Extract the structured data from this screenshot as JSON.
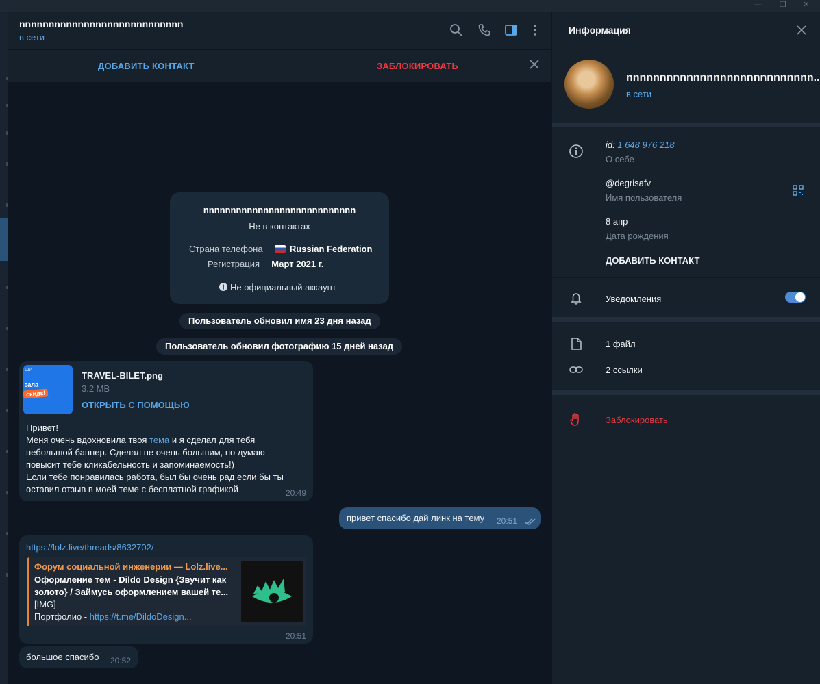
{
  "chat": {
    "header": {
      "name": "nnnnnnnnnnnnnnnnnnnnnnnnnnnn",
      "status": "в сети"
    },
    "actions": {
      "add_contact": "ДОБАВИТЬ КОНТАКТ",
      "block": "ЗАБЛОКИРОВАТЬ"
    },
    "info_card": {
      "name": "nnnnnnnnnnnnnnnnnnnnnnnnnnnn",
      "subtitle": "Не в контактах",
      "phone_country_label": "Страна телефона",
      "phone_country_value": "Russian Federation",
      "registration_label": "Регистрация",
      "registration_value": "Март 2021 г.",
      "warning": "Не официальный аккаунт"
    },
    "service_messages": [
      "Пользователь обновил имя 23 дня назад",
      "Пользователь обновил фотографию 15 дней назад"
    ],
    "messages": [
      {
        "file_name": "TRAVEL-BILET.png",
        "file_size": "3.2 MB",
        "open_with": "ОТКРЫТЬ С ПОМОЩЬЮ",
        "thumb_top": "ШИ",
        "thumb_line1": "зала —",
        "thumb_line2": "скидк!",
        "text_before_link": "Привет!\nМеня очень вдохновила твоя ",
        "link_text": "тема",
        "text_after_link": " и я сделал для тебя\nнебольшой баннер. Сделал не очень большим, но думаю\nповысит тебе кликабельность и запоминаемость!)\nЕсли тебе понравилась работа, был бы очень рад если бы ты\nоставил отзыв в моей теме с бесплатной графикой",
        "time": "20:49"
      },
      {
        "text": "привет спасибо дай линк на тему",
        "time": "20:51"
      },
      {
        "url": "https://lolz.live/threads/8632702/",
        "preview_site": "Форум социальной инженерии —  Lolz.live...",
        "preview_title": "Оформление тем - Dildo Design {Звучит как\nзолото} / Займусь оформлением вашей те...",
        "preview_desc_1": "[IMG]",
        "preview_desc_prefix": "Портфолио - ",
        "preview_desc_link": "https://t.me/DildoDesign...",
        "time": "20:51"
      },
      {
        "text": "большое спасибо",
        "time": "20:52"
      }
    ]
  },
  "panel": {
    "title": "Информация",
    "name": "nnnnnnnnnnnnnnnnnnnnnnnnnnnn...",
    "status": "в сети",
    "id_label": "id:",
    "id_value": "1 648 976 218",
    "about_label": "О себе",
    "username": "@degrisafv",
    "username_label": "Имя пользователя",
    "birthday": "8 апр",
    "birthday_label": "Дата рождения",
    "add_contact": "ДОБАВИТЬ КОНТАКТ",
    "notifications": "Уведомления",
    "notifications_on": true,
    "files": "1 файл",
    "links": "2 ссылки",
    "block": "Заблокировать"
  },
  "colors": {
    "accent": "#5aa6e6",
    "danger": "#ec3942",
    "bg": "#0e1621",
    "panel": "#17212b",
    "outgoing": "#2b5278",
    "incoming": "#182533"
  }
}
